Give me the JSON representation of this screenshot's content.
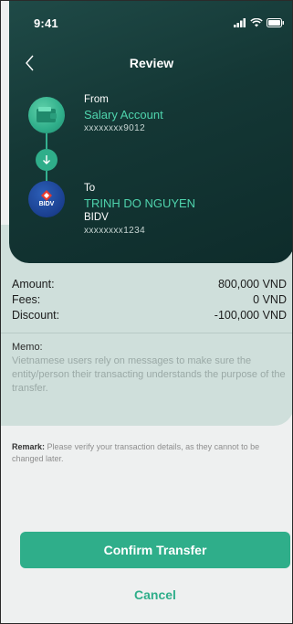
{
  "status_bar": {
    "time": "9:41"
  },
  "header": {
    "title": "Review"
  },
  "from": {
    "label": "From",
    "account_name": "Salary Account",
    "account_number": "xxxxxxxx9012"
  },
  "to": {
    "label": "To",
    "recipient_name": "TRINH DO NGUYEN",
    "bank": "BIDV",
    "bank_logo_text": "BIDV",
    "account_number": "xxxxxxxx1234"
  },
  "details": {
    "amount_label": "Amount:",
    "amount_value": "800,000 VND",
    "fees_label": "Fees:",
    "fees_value": "0 VND",
    "discount_label": "Discount:",
    "discount_value": "-100,000 VND",
    "memo_label": "Memo:",
    "memo_text": "Vietnamese users rely on messages to make sure the entity/person their transacting understands the purpose of the transfer."
  },
  "remark": {
    "label": "Remark:",
    "text": "Please verify your transaction details, as they cannot to be changed later."
  },
  "actions": {
    "confirm_label": "Confirm Transfer",
    "cancel_label": "Cancel"
  },
  "colors": {
    "accent": "#2fae8a",
    "header_bg": "#143735",
    "details_bg": "#cfdfdb"
  }
}
